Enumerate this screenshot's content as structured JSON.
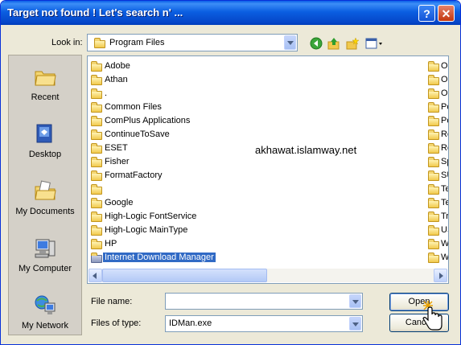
{
  "window": {
    "title": "Target not found ! Let's search n' ...",
    "help_label": "?",
    "close_label": "✕"
  },
  "lookin": {
    "label": "Look in:",
    "value": "Program Files"
  },
  "toolbar": {
    "icons": [
      "back-icon",
      "up-folder-icon",
      "new-folder-icon",
      "view-menu-icon"
    ]
  },
  "places": [
    {
      "label": "Recent",
      "icon": "recent-icon"
    },
    {
      "label": "Desktop",
      "icon": "desktop-icon"
    },
    {
      "label": "My Documents",
      "icon": "my-documents-icon"
    },
    {
      "label": "My Computer",
      "icon": "my-computer-icon"
    },
    {
      "label": "My Network",
      "icon": "my-network-icon"
    }
  ],
  "files": [
    {
      "label": "Adobe"
    },
    {
      "label": "Athan"
    },
    {
      "label": "."
    },
    {
      "label": "Common Files"
    },
    {
      "label": "ComPlus Applications"
    },
    {
      "label": "ContinueToSave"
    },
    {
      "label": "ESET"
    },
    {
      "label": "Fisher"
    },
    {
      "label": "FormatFactory"
    },
    {
      "label": ""
    },
    {
      "label": "Google"
    },
    {
      "label": "High-Logic FontService"
    },
    {
      "label": "High-Logic MainType"
    },
    {
      "label": "HP"
    },
    {
      "label": "Internet Download Manager",
      "selected": true
    }
  ],
  "files_col2": [
    "O",
    "O",
    "O",
    "Po",
    "Po",
    "Re",
    "Re",
    "Sp",
    "SU",
    "Te",
    "Te",
    "Tr",
    "US",
    "W",
    "W"
  ],
  "watermark": "akhawat.islamway.net",
  "filename": {
    "label": "File name:",
    "value": ""
  },
  "filetype": {
    "label": "Files of type:",
    "value": "IDMan.exe"
  },
  "buttons": {
    "open": "Open",
    "cancel": "Cancel"
  },
  "colors": {
    "selection": "#316ac5",
    "titlebar": "#0b5fe2"
  }
}
